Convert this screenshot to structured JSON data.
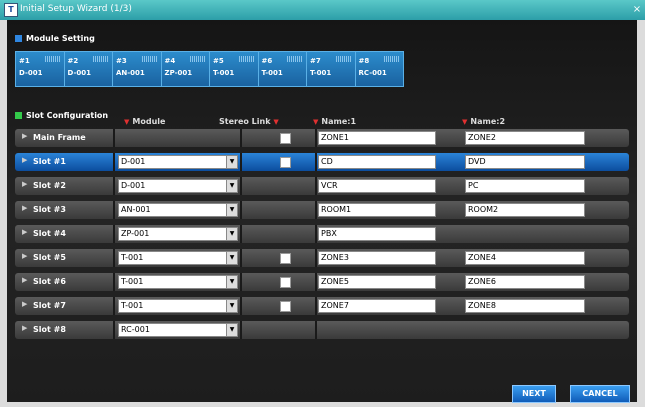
{
  "window": {
    "title": "Initial Setup Wizard (1/3)",
    "icon_text": "T",
    "close": "×"
  },
  "module_setting": {
    "heading": "Module Setting",
    "modules": [
      {
        "num": "#1",
        "name": "D-001"
      },
      {
        "num": "#2",
        "name": "D-001"
      },
      {
        "num": "#3",
        "name": "AN-001"
      },
      {
        "num": "#4",
        "name": "ZP-001"
      },
      {
        "num": "#5",
        "name": "T-001"
      },
      {
        "num": "#6",
        "name": "T-001"
      },
      {
        "num": "#7",
        "name": "T-001"
      },
      {
        "num": "#8",
        "name": "RC-001"
      }
    ]
  },
  "slot_config": {
    "heading": "Slot Configuration",
    "columns": {
      "module": "Module",
      "stereo": "Stereo Link",
      "name1": "Name:1",
      "name2": "Name:2"
    },
    "rows": [
      {
        "label": "Main Frame",
        "module": "",
        "stereo": true,
        "name1": "ZONE1",
        "name2": "ZONE2"
      },
      {
        "label": "Slot #1",
        "module": "D-001",
        "stereo": true,
        "name1": "CD",
        "name2": "DVD",
        "selected": true
      },
      {
        "label": "Slot #2",
        "module": "D-001",
        "stereo": false,
        "name1": "VCR",
        "name2": "PC"
      },
      {
        "label": "Slot #3",
        "module": "AN-001",
        "stereo": false,
        "name1": "ROOM1",
        "name2": "ROOM2"
      },
      {
        "label": "Slot #4",
        "module": "ZP-001",
        "stereo": false,
        "name1": "PBX",
        "name2": null
      },
      {
        "label": "Slot #5",
        "module": "T-001",
        "stereo": true,
        "name1": "ZONE3",
        "name2": "ZONE4"
      },
      {
        "label": "Slot #6",
        "module": "T-001",
        "stereo": true,
        "name1": "ZONE5",
        "name2": "ZONE6"
      },
      {
        "label": "Slot #7",
        "module": "T-001",
        "stereo": true,
        "name1": "ZONE7",
        "name2": "ZONE8"
      },
      {
        "label": "Slot #8",
        "module": "RC-001",
        "stereo": false,
        "name1": null,
        "name2": null
      }
    ]
  },
  "buttons": {
    "next": "NEXT",
    "cancel": "CANCEL"
  },
  "colors": {
    "accent": "#1a6fc4",
    "selected_row": "#0c4d9e",
    "module_header": "#1c6fa8",
    "sort_marker": "#e03030"
  }
}
